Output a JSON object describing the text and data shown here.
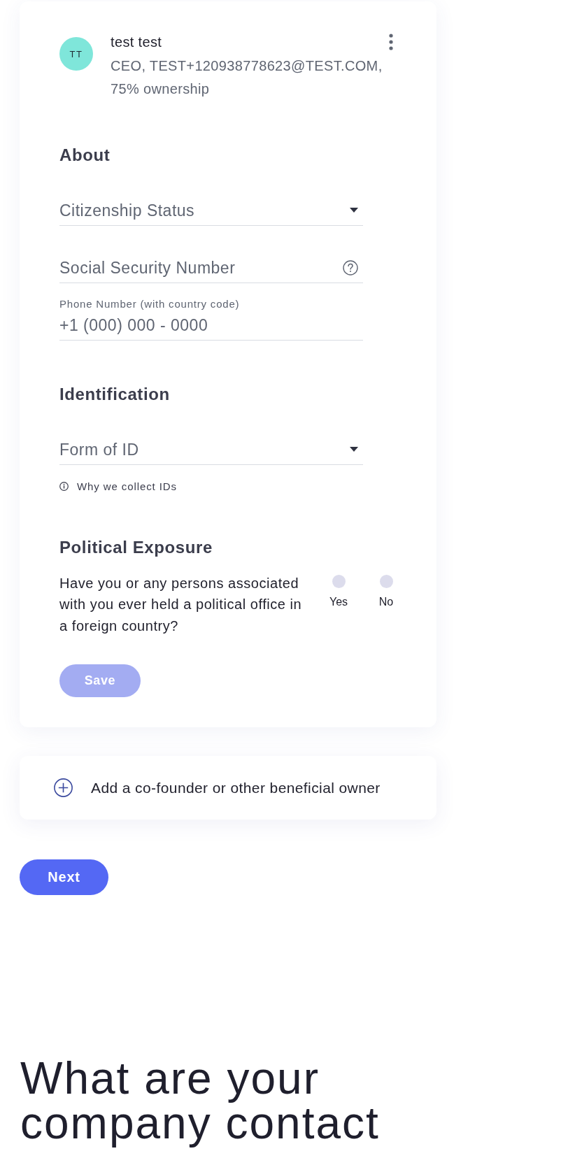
{
  "owner": {
    "initials": "TT",
    "name": "test test",
    "details": "CEO, TEST+120938778623@TEST.COM, 75% ownership"
  },
  "sections": [
    {
      "kind": "fields",
      "title": "About",
      "fields": [
        {
          "kind": "select",
          "placeholder": "Citizenship Status",
          "help_icon": false
        },
        {
          "kind": "text",
          "placeholder": "Social Security Number",
          "help_icon": true
        },
        {
          "kind": "text",
          "label": "Phone Number (with country code)",
          "placeholder": "+1 (000) 000 - 0000",
          "help_icon": false
        }
      ]
    },
    {
      "kind": "fields",
      "title": "Identification",
      "fields": [
        {
          "kind": "select",
          "placeholder": "Form of ID",
          "help_icon": false
        }
      ],
      "note": "Why we collect IDs"
    },
    {
      "kind": "question",
      "title": "Political Exposure",
      "question": "Have you or any persons associated with you ever held a political office in a foreign country?",
      "options": [
        {
          "label": "Yes",
          "selected": false
        },
        {
          "label": "No",
          "selected": false
        }
      ]
    }
  ],
  "save_button": {
    "label": "Save",
    "disabled": true
  },
  "add_owner": {
    "label": "Add a co-founder or other beneficial owner"
  },
  "next_button": {
    "label": "Next"
  },
  "next_heading": "What are your company contact"
}
